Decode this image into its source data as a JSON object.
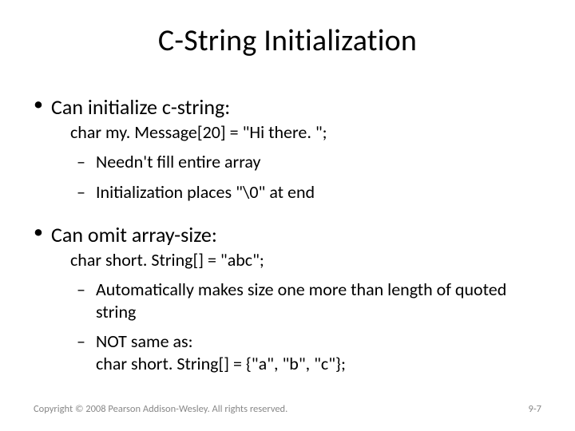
{
  "title": "C-String Initialization",
  "b1": {
    "text": "Can initialize c-string:",
    "code": "char my. Message[20] = \"Hi there. \";",
    "sub1": "Needn't fill entire array",
    "sub2": "Initialization places \"\\0\" at end"
  },
  "b2": {
    "text": "Can omit array-size:",
    "code": "char short. String[] = \"abc\";",
    "sub1": "Automatically makes size one more than length of quoted string",
    "sub2": "NOT same as:\nchar short. String[] = {\"a\", \"b\", \"c\"};"
  },
  "footer": {
    "copyright": "Copyright © 2008 Pearson Addison-Wesley. All rights reserved.",
    "pagenum": "9-7"
  }
}
